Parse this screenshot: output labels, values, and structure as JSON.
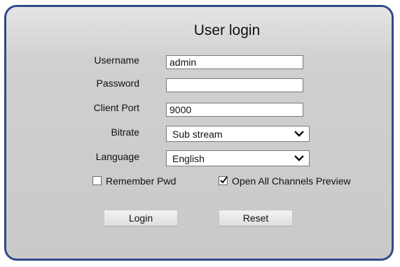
{
  "dialog": {
    "title": "User login"
  },
  "form": {
    "username": {
      "label": "Username",
      "value": "admin"
    },
    "password": {
      "label": "Password",
      "value": ""
    },
    "client_port": {
      "label": "Client Port",
      "value": "9000"
    },
    "bitrate": {
      "label": "Bitrate",
      "selected": "Sub stream"
    },
    "language": {
      "label": "Language",
      "selected": "English"
    }
  },
  "options": {
    "remember_pwd": {
      "label": "Remember Pwd",
      "checked": false
    },
    "open_all_channels": {
      "label": "Open All Channels Preview",
      "checked": true
    }
  },
  "buttons": {
    "login": "Login",
    "reset": "Reset"
  },
  "colors": {
    "border": "#2e4a8a",
    "panel": "#d0d0d0"
  }
}
